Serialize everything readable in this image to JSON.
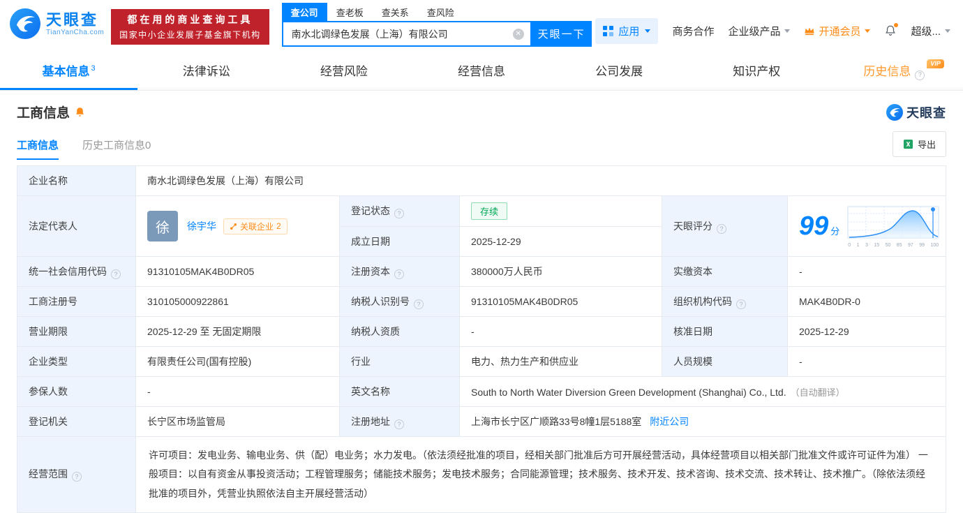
{
  "brand": {
    "name": "天眼查",
    "domain": "TianYanCha.com",
    "blue": "#0084ff",
    "orange": "#ff8c19"
  },
  "promo": {
    "line1": "都在用的商业查询工具",
    "line2": "国家中小企业发展子基金旗下机构"
  },
  "search": {
    "tabs": [
      {
        "label": "查公司",
        "active": true
      },
      {
        "label": "查老板"
      },
      {
        "label": "查关系"
      },
      {
        "label": "查风险"
      }
    ],
    "value": "南水北调绿色发展（上海）有限公司",
    "button": "天眼一下"
  },
  "top_nav": {
    "apps": "应用",
    "items": [
      "商务合作",
      "企业级产品",
      "开通会员",
      "超级..."
    ]
  },
  "main_tabs": [
    {
      "label": "基本信息",
      "count": "3"
    },
    {
      "label": "法律诉讼"
    },
    {
      "label": "经营风险"
    },
    {
      "label": "经营信息"
    },
    {
      "label": "公司发展"
    },
    {
      "label": "知识产权"
    },
    {
      "label": "历史信息",
      "vip": "VIP"
    }
  ],
  "section": {
    "title": "工商信息",
    "brand": "天眼查"
  },
  "subtabs": [
    {
      "label": "工商信息",
      "active": true
    },
    {
      "label": "历史工商信息",
      "count": "0"
    }
  ],
  "export": {
    "label": "导出"
  },
  "fields": {
    "company_name": {
      "label": "企业名称",
      "value": "南水北调绿色发展（上海）有限公司"
    },
    "legal_rep": {
      "label": "法定代表人",
      "avatar_char": "徐",
      "name": "徐宇华",
      "related_label": "关联企业",
      "related_count": "2"
    },
    "reg_status": {
      "label": "登记状态",
      "value": "存续"
    },
    "establish_date": {
      "label": "成立日期",
      "value": "2025-12-29"
    },
    "score": {
      "label": "天眼评分",
      "value": "99",
      "unit": "分"
    },
    "credit_code": {
      "label": "统一社会信用代码",
      "value": "91310105MAK4B0DR05"
    },
    "reg_capital": {
      "label": "注册资本",
      "value": "380000万人民币"
    },
    "paid_capital": {
      "label": "实缴资本",
      "value": "-"
    },
    "reg_number": {
      "label": "工商注册号",
      "value": "310105000922861"
    },
    "taxpayer_id": {
      "label": "纳税人识别号",
      "value": "91310105MAK4B0DR05"
    },
    "org_code": {
      "label": "组织机构代码",
      "value": "MAK4B0DR-0"
    },
    "business_term": {
      "label": "营业期限",
      "value": "2025-12-29 至 无固定期限"
    },
    "taxpayer_quality": {
      "label": "纳税人资质",
      "value": "-"
    },
    "approve_date": {
      "label": "核准日期",
      "value": "2025-12-29"
    },
    "company_type": {
      "label": "企业类型",
      "value": "有限责任公司(国有控股)"
    },
    "industry": {
      "label": "行业",
      "value": "电力、热力生产和供应业"
    },
    "staff_size": {
      "label": "人员规模",
      "value": "-"
    },
    "insured_count": {
      "label": "参保人数",
      "value": "-"
    },
    "english_name": {
      "label": "英文名称",
      "value": "South to North Water Diversion Green Development (Shanghai) Co., Ltd.",
      "note": "（自动翻译）"
    },
    "reg_authority": {
      "label": "登记机关",
      "value": "长宁区市场监管局"
    },
    "reg_address": {
      "label": "注册地址",
      "value": "上海市长宁区广顺路33号8幢1层5188室",
      "link": "附近公司"
    },
    "business_scope": {
      "label": "经营范围",
      "value": "许可项目：发电业务、输电业务、供（配）电业务；水力发电。（依法须经批准的项目，经相关部门批准后方可开展经营活动，具体经营项目以相关部门批准文件或许可证件为准） 一般项目：以自有资金从事投资活动；工程管理服务；储能技术服务；发电技术服务；合同能源管理；技术服务、技术开发、技术咨询、技术交流、技术转让、技术推广。（除依法须经批准的项目外，凭营业执照依法自主开展经营活动）"
    }
  },
  "score_chart": {
    "ticks": [
      "0",
      "1",
      "3",
      "15",
      "50",
      "85",
      "97",
      "99",
      "100"
    ]
  },
  "icons": {
    "help": "?",
    "clear": "✕"
  }
}
